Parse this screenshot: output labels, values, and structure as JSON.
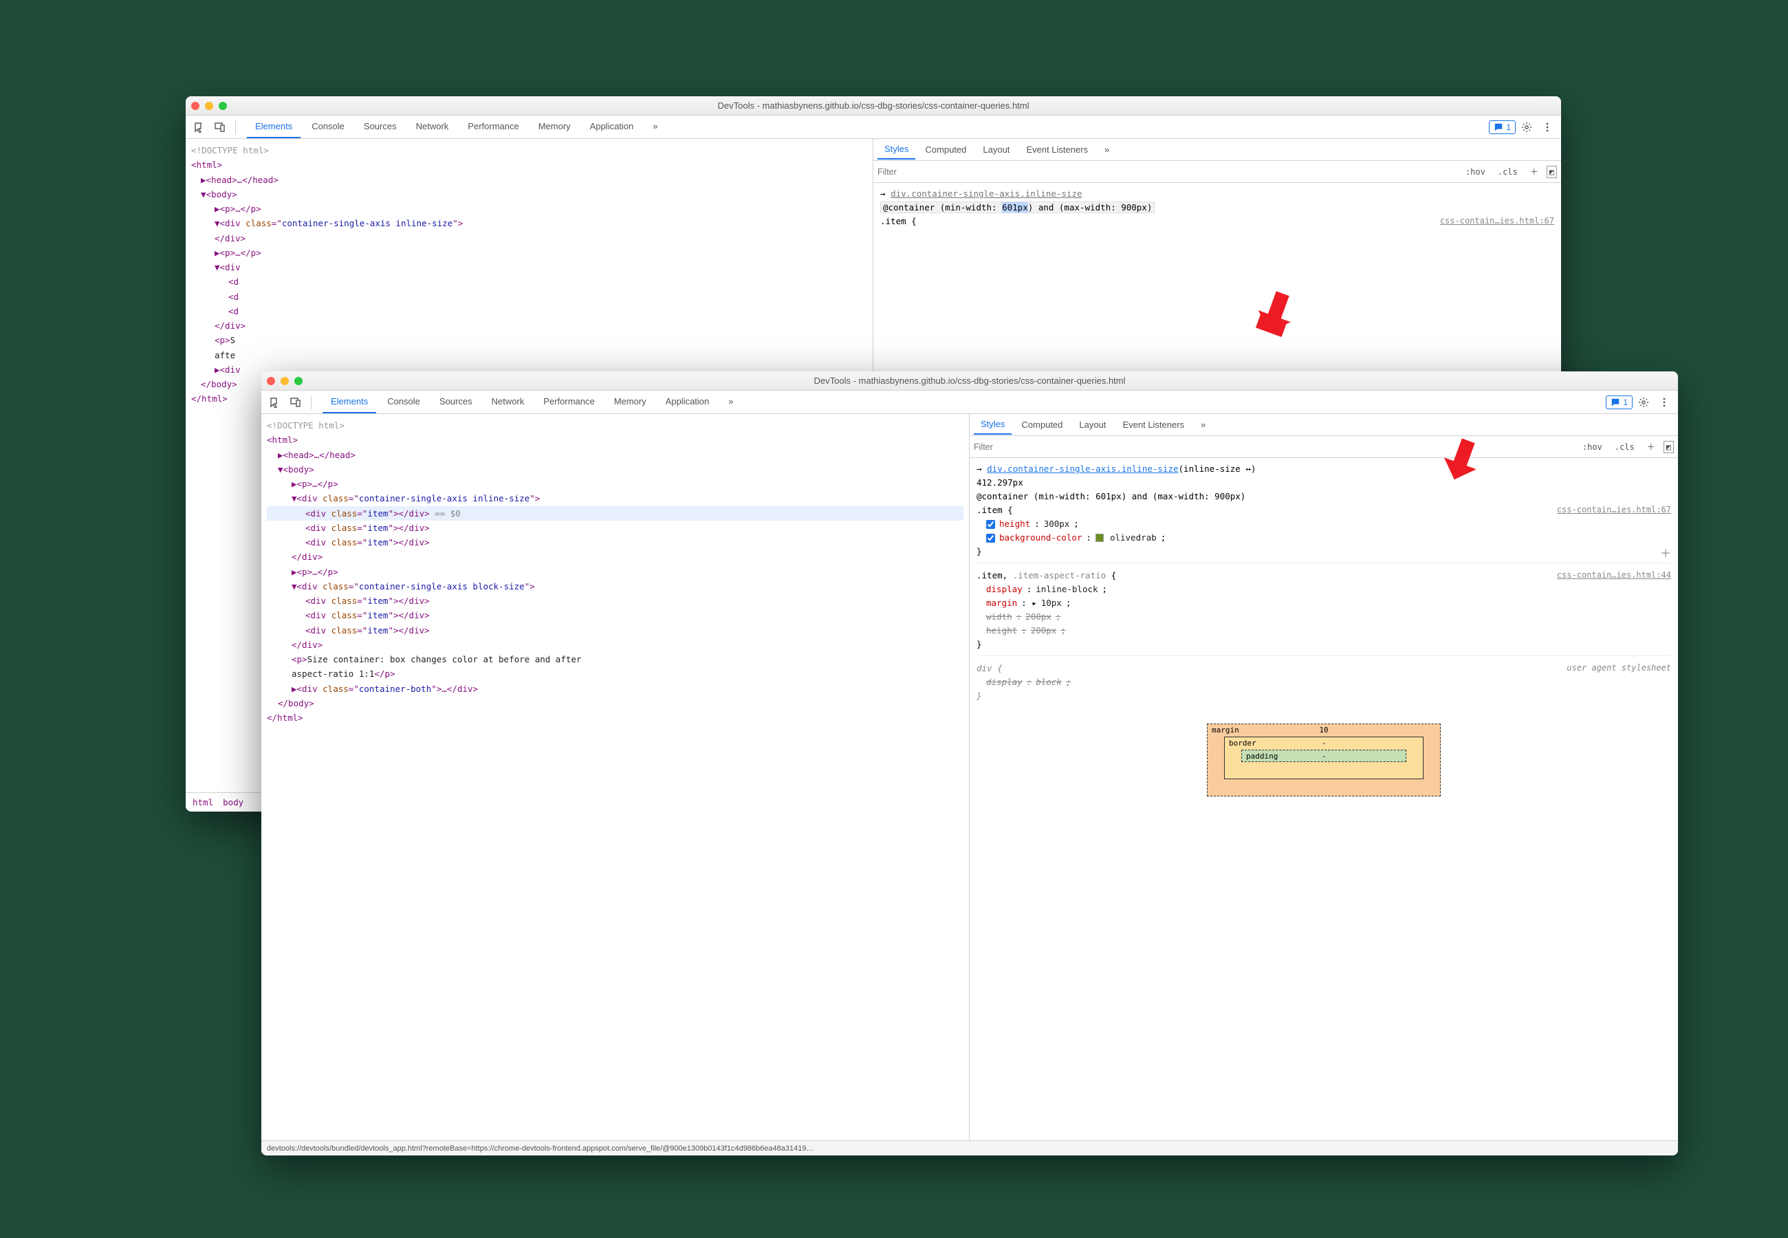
{
  "window_back": {
    "title": "DevTools - mathiasbynens.github.io/css-dbg-stories/css-container-queries.html",
    "tabs": [
      "Elements",
      "Console",
      "Sources",
      "Network",
      "Performance",
      "Memory",
      "Application"
    ],
    "active_tab": "Elements",
    "overflow": "»",
    "messages": "1",
    "subtabs": [
      "Styles",
      "Computed",
      "Layout",
      "Event Listeners"
    ],
    "active_subtab": "Styles",
    "filter_placeholder": "Filter",
    "hov": ":hov",
    "cls": ".cls",
    "dom": {
      "l0": "<!DOCTYPE html>",
      "l1": "<html>",
      "l2": "▶<head>…</head>",
      "l3": "▼<body>",
      "l4": "▶<p>…</p>",
      "l5_open": "▼<div ",
      "l5_class": "class",
      "l5_eq": "=\"",
      "l5_val": "container-single-axis inline-size",
      "l5_close": "\">",
      "l7": "</div>",
      "l8": "▶<p>…</p>",
      "l9": "▼<div",
      "l10": "<d",
      "l11": "<d",
      "l12": "<d",
      "l13": "</div>",
      "l14": "<p>S",
      "l15": "afte",
      "l16": "▶<div",
      "l17": "</body>",
      "l18": "</html>"
    },
    "rule": {
      "sel_link": "div.container-single-axis.inline-size",
      "container": "@container (min-width: 601px) and (max-width: 900px)",
      "highlight": "601px",
      "item": ".item {",
      "src": "css-contain…ies.html:67"
    },
    "crumbs": [
      "html",
      "body"
    ]
  },
  "window_front": {
    "title": "DevTools - mathiasbynens.github.io/css-dbg-stories/css-container-queries.html",
    "tabs": [
      "Elements",
      "Console",
      "Sources",
      "Network",
      "Performance",
      "Memory",
      "Application"
    ],
    "active_tab": "Elements",
    "overflow": "»",
    "messages": "1",
    "subtabs": [
      "Styles",
      "Computed",
      "Layout",
      "Event Listeners"
    ],
    "active_subtab": "Styles",
    "filter_placeholder": "Filter",
    "hov": ":hov",
    "cls": ".cls",
    "dom": {
      "doctype": "<!DOCTYPE html>",
      "html_open": "<html>",
      "head": "▶<head>…</head>",
      "body_open": "▼<body>",
      "p1": "▶<p>…</p>",
      "div1_pre": "▼<div ",
      "div1_class": "class",
      "div1_val": "container-single-axis inline-size",
      "item_pre": "<div ",
      "item_class": "class",
      "item_val": "item",
      "item_close": "></div>",
      "eq0": " == $0",
      "div1_close": "</div>",
      "p2": "▶<p>…</p>",
      "div2_pre": "▼<div ",
      "div2_val": "container-single-axis block-size",
      "div2_close": "</div>",
      "ptext_open": "<p>",
      "ptext": "Size container: box changes color at before and after aspect-ratio 1:1",
      "ptext_close": "</p>",
      "div3_pre": "▶<div ",
      "div3_val": "container-both",
      "div3_rest": ">…</div>",
      "body_close": "</body>",
      "html_close": "</html>"
    },
    "styles": {
      "src1": "css-contain…ies.html:67",
      "src2": "css-contain…ies.html:44",
      "sel_link": "div.container-single-axis.inline-size",
      "container_info": "(inline-size ↔) 412.297px",
      "container_info_a": "(inline-size",
      "container_info_b": "412.297px",
      "at": "@container (min-width: 601px) and (max-width: 900px)",
      "r1_sel": ".item {",
      "p_height_k": "height",
      "p_height_v": "300px",
      "p_bg_k": "background-color",
      "p_bg_v": "olivedrab",
      "r2_sel_a": ".item",
      "r2_sel_b": ".item-aspect-ratio",
      "p_disp_k": "display",
      "p_disp_v": "inline-block",
      "p_margin_k": "margin",
      "p_margin_v": "10px",
      "p_width_k": "width",
      "p_width_v": "200px",
      "p_height2_k": "height",
      "p_height2_v": "200px",
      "ua_label": "user agent stylesheet",
      "ua_sel": "div {",
      "ua_disp_k": "display",
      "ua_disp_v": "block"
    },
    "boxmodel": {
      "margin": "margin",
      "margin_v": "10",
      "border": "border",
      "border_v": "-",
      "padding": "padding",
      "padding_v": "-"
    },
    "status": "devtools://devtools/bundled/devtools_app.html?remoteBase=https://chrome-devtools-frontend.appspot.com/serve_file/@900e1309b0143f1c4d986b6ea48a31419…"
  }
}
